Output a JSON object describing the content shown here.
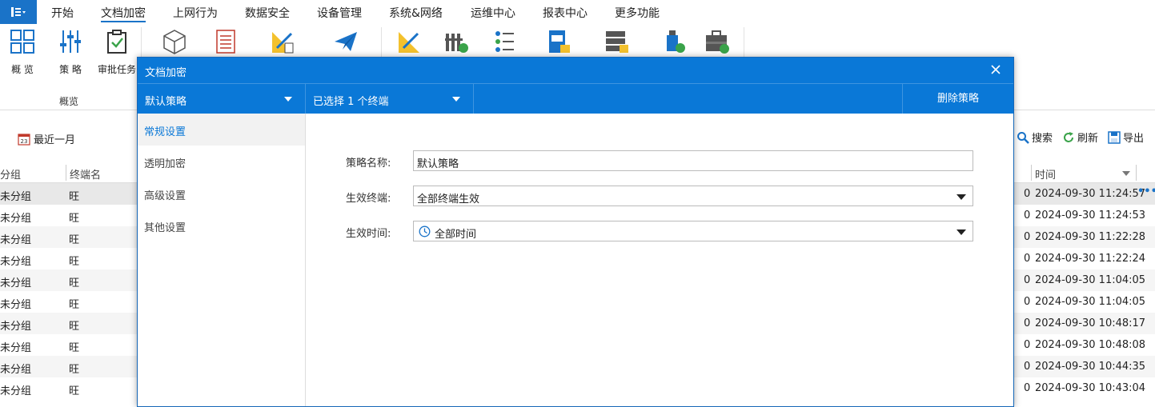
{
  "tabs": [
    "开始",
    "文档加密",
    "上网行为",
    "数据安全",
    "设备管理",
    "系统&网络",
    "运维中心",
    "报表中心",
    "更多功能"
  ],
  "active_tab": "文档加密",
  "ribbon": {
    "buttons": [
      {
        "label": "概 览",
        "icon": "grid-icon"
      },
      {
        "label": "策 略",
        "icon": "sliders-icon"
      },
      {
        "label": "审批任务",
        "icon": "clipboard-check-icon"
      }
    ],
    "group_label": "概览"
  },
  "filter": {
    "date_range": "最近一月"
  },
  "toolbar": {
    "search": "搜索",
    "refresh": "刷新",
    "export": "导出"
  },
  "table": {
    "headers": {
      "group": "分组",
      "terminal": "终端名",
      "time": "时间"
    },
    "rows": [
      {
        "group": "未分组",
        "terminal": "旺",
        "count": "0",
        "time": "2024-09-30 11:24:57"
      },
      {
        "group": "未分组",
        "terminal": "旺",
        "count": "0",
        "time": "2024-09-30 11:24:53"
      },
      {
        "group": "未分组",
        "terminal": "旺",
        "count": "0",
        "time": "2024-09-30 11:22:28"
      },
      {
        "group": "未分组",
        "terminal": "旺",
        "count": "0",
        "time": "2024-09-30 11:22:24"
      },
      {
        "group": "未分组",
        "terminal": "旺",
        "count": "0",
        "time": "2024-09-30 11:04:05"
      },
      {
        "group": "未分组",
        "terminal": "旺",
        "count": "0",
        "time": "2024-09-30 11:04:05"
      },
      {
        "group": "未分组",
        "terminal": "旺",
        "count": "0",
        "time": "2024-09-30 10:48:17"
      },
      {
        "group": "未分组",
        "terminal": "旺",
        "count": "0",
        "time": "2024-09-30 10:48:08"
      },
      {
        "group": "未分组",
        "terminal": "旺",
        "count": "0",
        "time": "2024-09-30 10:44:35"
      },
      {
        "group": "未分组",
        "terminal": "旺",
        "count": "0",
        "time": "2024-09-30 10:43:04"
      }
    ]
  },
  "modal": {
    "title": "文档加密",
    "policy_select": "默认策略",
    "terminal_select": "已选择 1 个终端",
    "delete_label": "删除策略",
    "sidebar": [
      "常规设置",
      "透明加密",
      "高级设置",
      "其他设置"
    ],
    "active_section": "常规设置",
    "form": {
      "name_label": "策略名称:",
      "name_value": "默认策略",
      "terminal_label": "生效终端:",
      "terminal_value": "全部终端生效",
      "time_label": "生效时间:",
      "time_value": "全部时间"
    }
  },
  "colors": {
    "accent": "#0a78d7",
    "selected_row": "#e8e8e8"
  }
}
